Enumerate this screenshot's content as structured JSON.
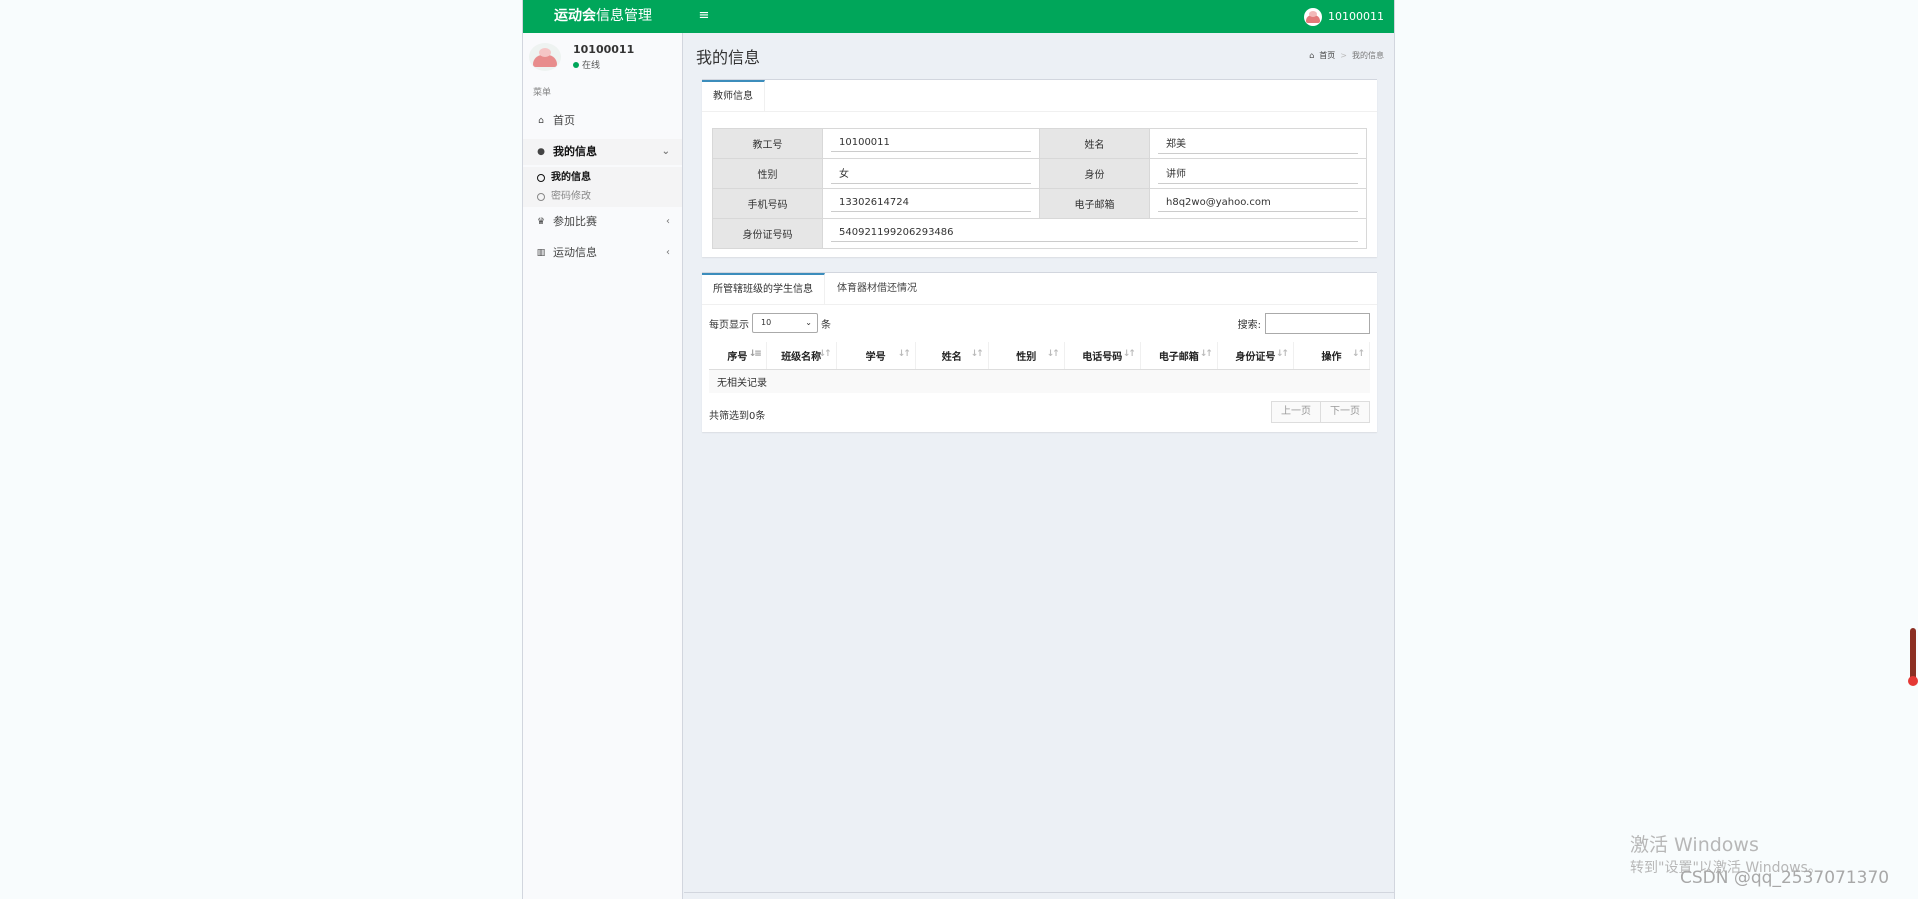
{
  "header": {
    "logo_bold": "运动会",
    "logo_rest": "信息管理",
    "toggle_glyph": "≡",
    "user_id": "10100011"
  },
  "sidebar": {
    "user_name": "10100011",
    "user_status": "在线",
    "menu_header": "菜单",
    "items": [
      {
        "label": "首页",
        "icon": "home-icon",
        "glyph": "⌂"
      },
      {
        "label": "我的信息",
        "icon": "user-icon",
        "glyph": "●",
        "arrow": "⌄"
      },
      {
        "label": "参加比赛",
        "icon": "trophy-icon",
        "glyph": "♛",
        "arrow": "‹"
      },
      {
        "label": "运动信息",
        "icon": "bar-chart-icon",
        "glyph": "▥",
        "arrow": "‹"
      }
    ],
    "sub_items": [
      {
        "label": "我的信息"
      },
      {
        "label": "密码修改"
      }
    ]
  },
  "page": {
    "title": "我的信息",
    "breadcrumb_home": "首页",
    "breadcrumb_sep": ">",
    "breadcrumb_current": "我的信息"
  },
  "teacher_box": {
    "tab": "教师信息",
    "rows": [
      {
        "l1": "教工号",
        "v1": "10100011",
        "l2": "姓名",
        "v2": "郑美"
      },
      {
        "l1": "性别",
        "v1": "女",
        "l2": "身份",
        "v2": "讲师"
      },
      {
        "l1": "手机号码",
        "v1": "13302614724",
        "l2": "电子邮箱",
        "v2": "h8q2wo@yahoo.com"
      },
      {
        "l1": "身份证号码",
        "v1": "540921199206293486"
      }
    ]
  },
  "student_box": {
    "tabs": [
      "所管辖班级的学生信息",
      "体育器材借还情况"
    ],
    "length_prefix": "每页显示",
    "length_value": "10",
    "length_suffix": "条",
    "search_label": "搜索:",
    "columns": [
      "序号",
      "班级名称",
      "学号",
      "姓名",
      "性别",
      "电话号码",
      "电子邮箱",
      "身份证号",
      "操作"
    ],
    "empty_text": "无相关记录",
    "info_text": "共筛选到0条",
    "prev": "上一页",
    "next": "下一页"
  },
  "watermark": {
    "line1": "激活 Windows",
    "line2": "转到\"设置\"以激活 Windows。",
    "csdn": "CSDN @qq_2537071370"
  },
  "colors": {
    "header_green": "#00a65a",
    "tab_accent": "#3c8dbc"
  }
}
